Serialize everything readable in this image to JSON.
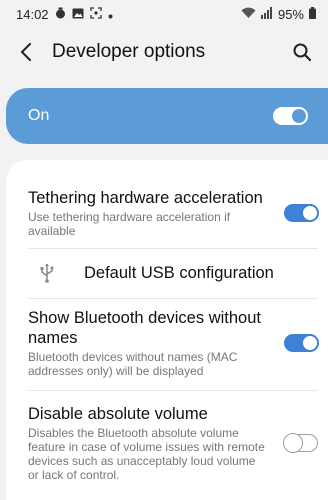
{
  "status_bar": {
    "time": "14:02",
    "battery": "95%",
    "icons": [
      "fitness-icon",
      "gallery-icon",
      "screenshot-icon",
      "dot-icon",
      "wifi-icon",
      "signal-icon",
      "battery-icon"
    ]
  },
  "app_bar": {
    "title": "Developer options",
    "icons": [
      "back-icon",
      "search-icon"
    ]
  },
  "master_switch": {
    "label": "On",
    "state": true
  },
  "settings": [
    {
      "title": "Tethering hardware acceleration",
      "subtitle": "Use tethering hardware acceleration if available",
      "state": true
    },
    {
      "title": "Default USB configuration",
      "icon": "usb-icon"
    },
    {
      "title": "Show Bluetooth devices without names",
      "subtitle": "Bluetooth devices without names (MAC addresses only) will be displayed",
      "state": true
    },
    {
      "title": "Disable absolute volume",
      "subtitle": "Disables the Bluetooth absolute volume feature in case of volume issues with remote devices such as unacceptably loud volume or lack of control.",
      "state": false
    }
  ],
  "colors": {
    "accent": "#3e82d8",
    "master_bg": "#5b9bd6",
    "page_bg": "#f2f2f2"
  }
}
